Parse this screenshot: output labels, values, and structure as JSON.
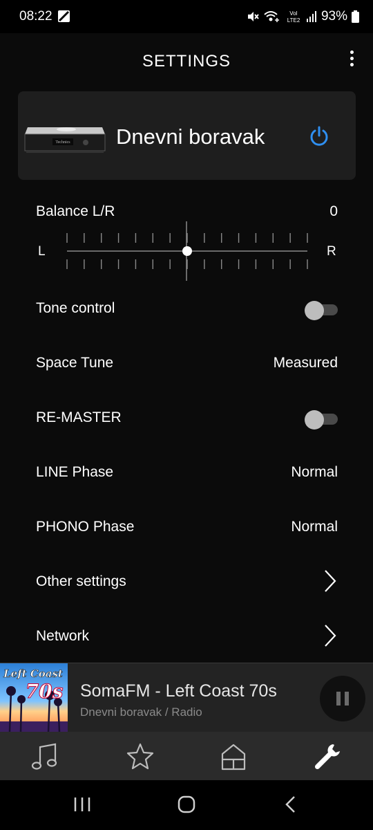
{
  "status_bar": {
    "time": "08:22",
    "battery": "93%",
    "icons": [
      "image-notification-icon",
      "mute-icon",
      "wifi-calling-icon",
      "volte-lte2-icon",
      "signal-icon",
      "battery-icon"
    ],
    "volte_label": "VoI",
    "lte_label": "LTE2"
  },
  "header": {
    "title": "SETTINGS",
    "menu_icon": "more-vert-icon"
  },
  "device": {
    "name": "Dnevni boravak",
    "image": "amplifier-device-image",
    "brand_text": "Technics",
    "power_icon": "power-icon",
    "accent_color": "#2f8ff0"
  },
  "balance": {
    "label": "Balance L/R",
    "value": "0",
    "left_label": "L",
    "right_label": "R",
    "position": 0.5
  },
  "settings": {
    "tone_control": {
      "label": "Tone control",
      "enabled": false
    },
    "space_tune": {
      "label": "Space Tune",
      "value": "Measured"
    },
    "remaster": {
      "label": "RE-MASTER",
      "enabled": false
    },
    "line_phase": {
      "label": "LINE Phase",
      "value": "Normal"
    },
    "phono_phase": {
      "label": "PHONO Phase",
      "value": "Normal"
    },
    "other_settings": {
      "label": "Other settings",
      "icon": "chevron-right-icon"
    },
    "network": {
      "label": "Network",
      "icon": "chevron-right-icon"
    }
  },
  "now_playing": {
    "title": "SomaFM - Left Coast 70s",
    "subtitle": "Dnevni boravak / Radio",
    "art_line1": "Left Coast",
    "art_line2": "70s",
    "control_icon": "pause-icon"
  },
  "bottom_nav": {
    "items": [
      {
        "name": "music",
        "icon": "music-note-icon"
      },
      {
        "name": "favorites",
        "icon": "star-icon"
      },
      {
        "name": "rooms",
        "icon": "house-icon"
      },
      {
        "name": "settings",
        "icon": "wrench-icon",
        "active": true
      }
    ]
  },
  "system_nav": {
    "icons": [
      "recents-icon",
      "home-icon",
      "back-icon"
    ]
  }
}
